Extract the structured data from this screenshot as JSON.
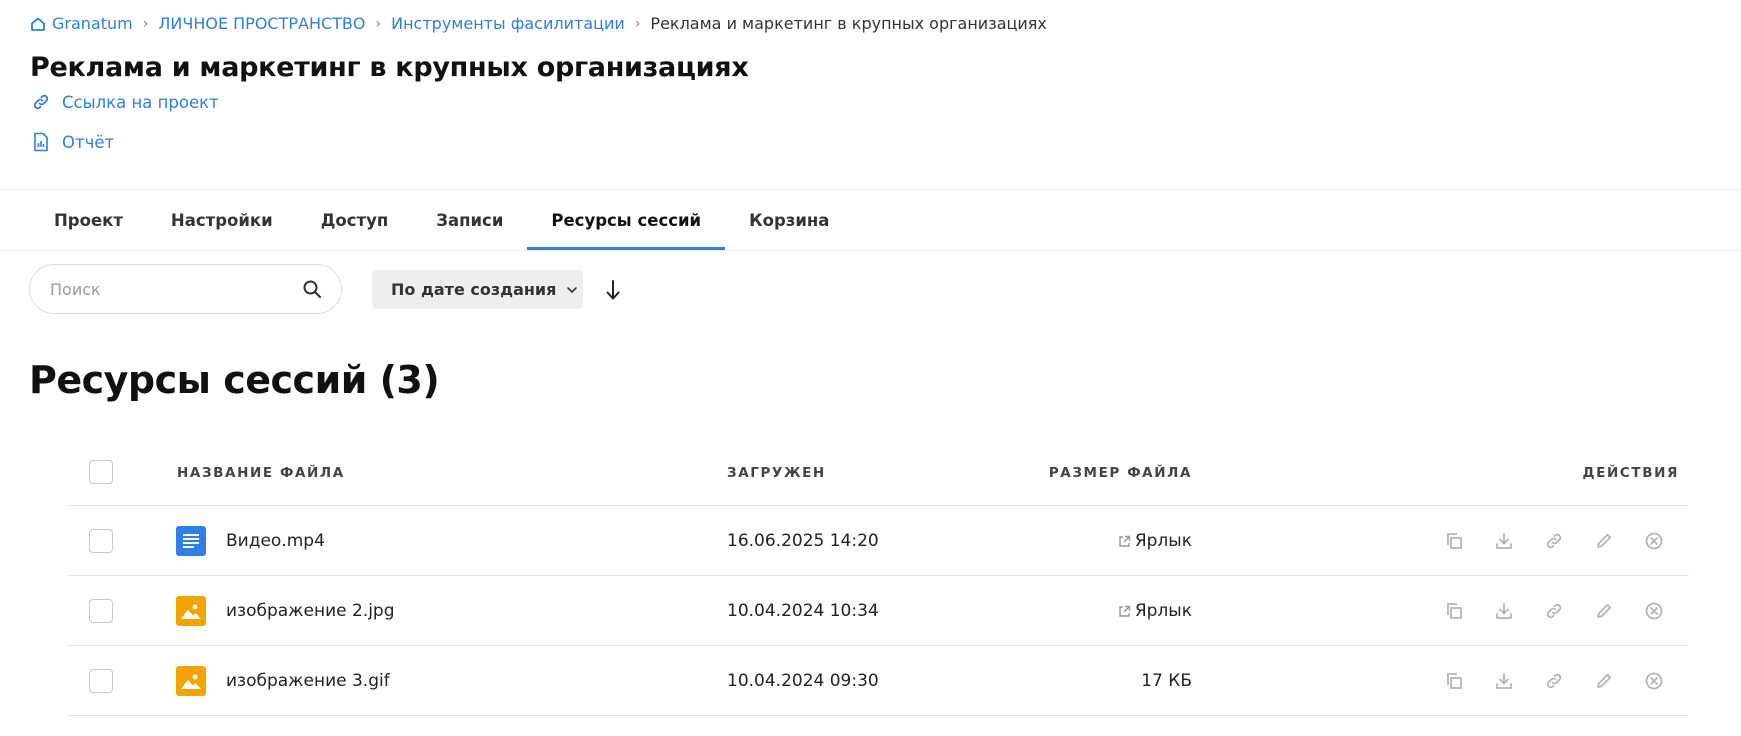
{
  "breadcrumb": {
    "items": [
      "Granatum",
      "ЛИЧНОЕ ПРОСТРАНСТВО",
      "Инструменты фасилитации"
    ],
    "current": "Реклама и маркетинг в крупных организациях"
  },
  "page": {
    "title": "Реклама и маркетинг в крупных организациях",
    "project_link_label": "Ссылка на проект",
    "report_label": "Отчёт"
  },
  "tabs": [
    {
      "label": "Проект",
      "active": false
    },
    {
      "label": "Настройки",
      "active": false
    },
    {
      "label": "Доступ",
      "active": false
    },
    {
      "label": "Записи",
      "active": false
    },
    {
      "label": "Ресурсы сессий",
      "active": true
    },
    {
      "label": "Корзина",
      "active": false
    }
  ],
  "toolbar": {
    "search_placeholder": "Поиск",
    "search_value": "",
    "sort_label": "По дате создания",
    "sort_direction": "descending"
  },
  "section": {
    "title": "Ресурсы сессий (3)"
  },
  "table": {
    "columns": {
      "name": "НАЗВАНИЕ ФАЙЛА",
      "uploaded": "ЗАГРУЖЕН",
      "size": "РАЗМЕР ФАЙЛА",
      "actions": "ДЕЙСТВИЯ"
    },
    "rows": [
      {
        "name": "Видео.mp4",
        "uploaded": "16.06.2025 14:20",
        "size": "Ярлык",
        "is_shortcut": true,
        "icon": "document-icon"
      },
      {
        "name": "изображение 2.jpg",
        "uploaded": "10.04.2024 10:34",
        "size": "Ярлык",
        "is_shortcut": true,
        "icon": "image-icon"
      },
      {
        "name": "изображение 3.gif",
        "uploaded": "10.04.2024 09:30",
        "size": "17 КБ",
        "is_shortcut": false,
        "icon": "image-icon"
      }
    ],
    "row_actions": [
      "copy-icon",
      "download-icon",
      "link-icon",
      "edit-icon",
      "delete-icon"
    ]
  },
  "colors": {
    "accent": "#2f7fd8",
    "doc_icon_bg": "#2f7fe8",
    "image_icon_bg": "#f5a300",
    "action_icon": "#b5b5b5"
  }
}
